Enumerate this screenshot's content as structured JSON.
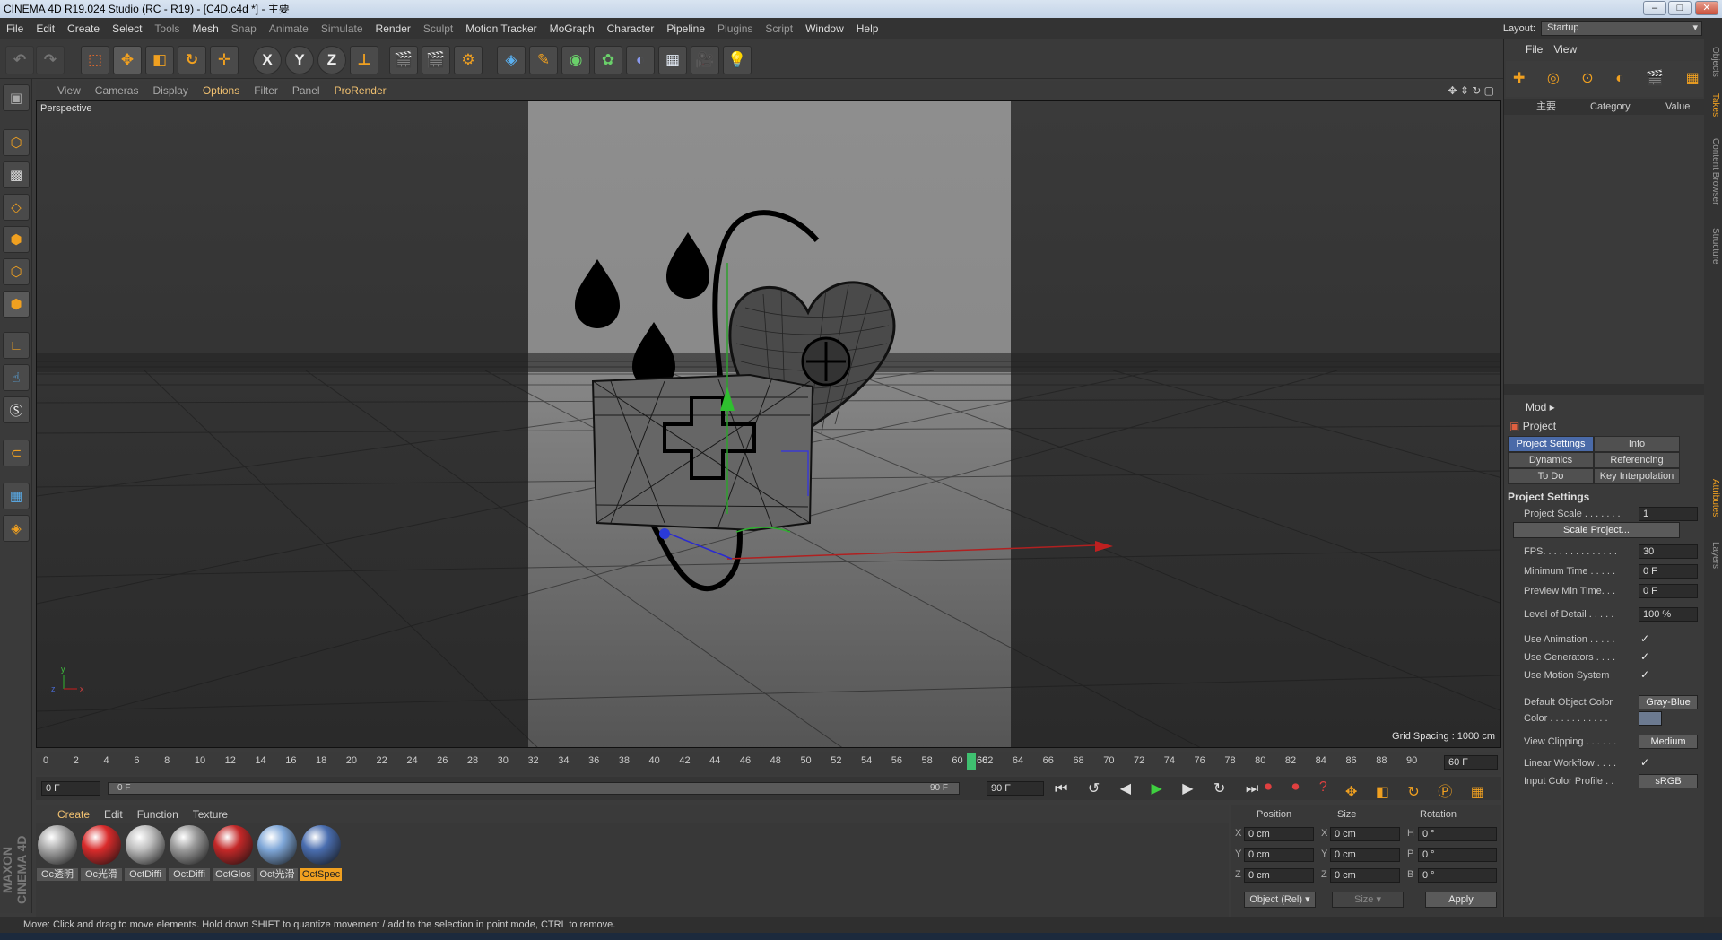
{
  "window": {
    "title": "CINEMA 4D R19.024 Studio (RC - R19) - [C4D.c4d *] - 主要",
    "controls": [
      "–",
      "□",
      "✕"
    ]
  },
  "menu": {
    "items": [
      "File",
      "Edit",
      "Create",
      "Select",
      "Tools",
      "Mesh",
      "Snap",
      "Animate",
      "Simulate",
      "Render",
      "Sculpt",
      "Motion Tracker",
      "MoGraph",
      "Character",
      "Pipeline",
      "Plugins",
      "Script",
      "Window",
      "Help"
    ],
    "layout_label": "Layout:",
    "layout_value": "Startup"
  },
  "toolbar": {
    "axis_x": "X",
    "axis_y": "Y",
    "axis_z": "Z"
  },
  "viewport": {
    "menu": [
      "View",
      "Cameras",
      "Display",
      "Options",
      "Filter",
      "Panel",
      "ProRender"
    ],
    "label": "Perspective",
    "grid_spacing": "Grid Spacing : 1000 cm",
    "axis_y": "y",
    "axis_x": "x",
    "axis_z": "z"
  },
  "timeline": {
    "ticks": [
      "0",
      "2",
      "4",
      "6",
      "8",
      "10",
      "12",
      "14",
      "16",
      "18",
      "20",
      "22",
      "24",
      "26",
      "28",
      "30",
      "32",
      "34",
      "36",
      "38",
      "40",
      "42",
      "44",
      "46",
      "48",
      "50",
      "52",
      "54",
      "56",
      "58",
      "60",
      "62",
      "64",
      "66",
      "68",
      "70",
      "72",
      "74",
      "76",
      "78",
      "80",
      "82",
      "84",
      "86",
      "88",
      "90"
    ],
    "current_frame": "60",
    "end_field": "60 F"
  },
  "transport": {
    "start": "0 F",
    "slider_start": "0 F",
    "slider_end": "90 F",
    "end": "90 F"
  },
  "materials": {
    "menu": [
      "Create",
      "Edit",
      "Function",
      "Texture"
    ],
    "items": [
      {
        "label": "Oc透明",
        "color": "#a8a8a8"
      },
      {
        "label": "Oc光滑",
        "color": "#d92b2b"
      },
      {
        "label": "OctDiffi",
        "color": "#bdbdbd"
      },
      {
        "label": "OctDiffi",
        "color": "#9a9a9a"
      },
      {
        "label": "OctGlos",
        "color": "#c42828"
      },
      {
        "label": "Oct光滑",
        "color": "#7fa7d8"
      },
      {
        "label": "OctSpec",
        "color": "#4a6eb0"
      }
    ],
    "brand_line1": "MAXON",
    "brand_line2": "CINEMA 4D"
  },
  "coords": {
    "headers": [
      "Position",
      "Size",
      "Rotation"
    ],
    "rows": [
      {
        "axis": "X",
        "pos": "0 cm",
        "saxis": "X",
        "size": "0 cm",
        "raxis": "H",
        "rot": "0 °"
      },
      {
        "axis": "Y",
        "pos": "0 cm",
        "saxis": "Y",
        "size": "0 cm",
        "raxis": "P",
        "rot": "0 °"
      },
      {
        "axis": "Z",
        "pos": "0 cm",
        "saxis": "Z",
        "size": "0 cm",
        "raxis": "B",
        "rot": "0 °"
      }
    ],
    "mode": "Object (Rel)",
    "size_mode": "Size",
    "apply": "Apply"
  },
  "objects": {
    "menu": [
      "File",
      "View"
    ],
    "name_col": "主要",
    "category_col": "Category",
    "value_col": "Value"
  },
  "attributes": {
    "mode": "Mod",
    "title": "Project",
    "tabs": [
      "Project Settings",
      "Info",
      "Dynamics",
      "Referencing",
      "To Do",
      "Key Interpolation"
    ],
    "section": "Project Settings",
    "rows": [
      {
        "label": "Project Scale . . . . . . .",
        "value": "1"
      },
      {
        "label": "FPS. . . . . . . . . . . . . .",
        "value": "30"
      },
      {
        "label": "Minimum Time . . . . .",
        "value": "0 F"
      },
      {
        "label": "Preview Min Time. . .",
        "value": "0 F"
      },
      {
        "label": "Level of Detail . . . . .",
        "value": "100 %"
      },
      {
        "label": "Use Animation . . . . .",
        "value": "✓"
      },
      {
        "label": "Use Generators . . . .",
        "value": "✓"
      },
      {
        "label": "Use Motion System",
        "value": "✓"
      },
      {
        "label": "Default Object Color",
        "value": "Gray-Blue"
      },
      {
        "label": "Color . . . . . . . . . . .",
        "value": ""
      },
      {
        "label": "View Clipping . . . . . .",
        "value": "Medium"
      },
      {
        "label": "Linear Workflow . . . .",
        "value": "✓"
      },
      {
        "label": "Input Color Profile . .",
        "value": "sRGB"
      }
    ],
    "scale_button": "Scale Project..."
  },
  "side_tabs": [
    "Objects",
    "Takes",
    "Content Browser",
    "Structure",
    "Attributes",
    "Layers"
  ],
  "status": "Move: Click and drag to move elements. Hold down SHIFT to quantize movement / add to the selection in point mode, CTRL to remove."
}
